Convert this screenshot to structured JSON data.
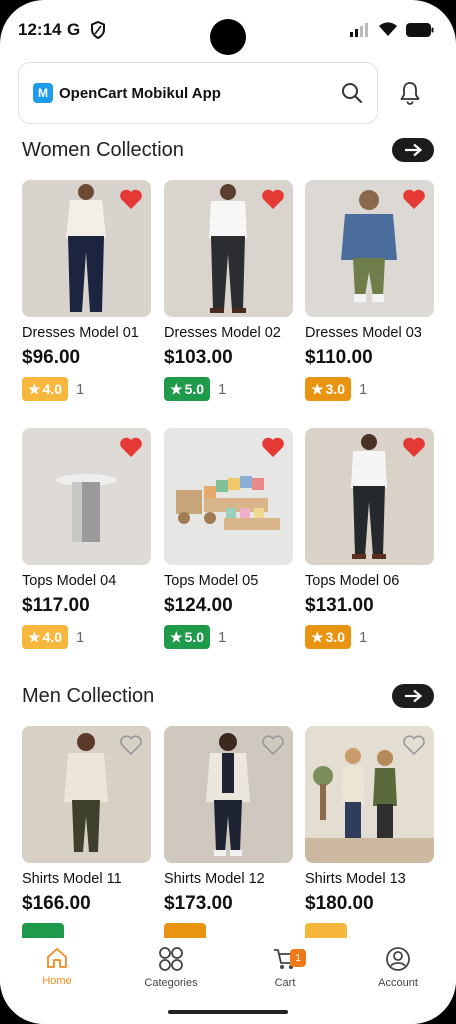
{
  "status": {
    "time": "12:14",
    "g_glyph": "G"
  },
  "header": {
    "logo_glyph": "M",
    "app_title": "OpenCart Mobikul App"
  },
  "sections": [
    {
      "title": "Women Collection"
    },
    {
      "title": "Men Collection"
    }
  ],
  "products": [
    {
      "name": "Dresses Model 01",
      "price": "$96.00",
      "rating": "4.0",
      "count": "1",
      "rating_color": "#f6b73c",
      "wishlisted": true
    },
    {
      "name": "Dresses Model 02",
      "price": "$103.00",
      "rating": "5.0",
      "count": "1",
      "rating_color": "#1f9a4a",
      "wishlisted": true
    },
    {
      "name": "Dresses Model 03",
      "price": "$110.00",
      "rating": "3.0",
      "count": "1",
      "rating_color": "#e89410",
      "wishlisted": true
    },
    {
      "name": "Tops Model 04",
      "price": "$117.00",
      "rating": "4.0",
      "count": "1",
      "rating_color": "#f6b73c",
      "wishlisted": true
    },
    {
      "name": "Tops Model 05",
      "price": "$124.00",
      "rating": "5.0",
      "count": "1",
      "rating_color": "#1f9a4a",
      "wishlisted": true
    },
    {
      "name": "Tops Model 06",
      "price": "$131.00",
      "rating": "3.0",
      "count": "1",
      "rating_color": "#e89410",
      "wishlisted": true
    },
    {
      "name": "Shirts Model 11",
      "price": "$166.00",
      "rating_color": "#1f9a4a",
      "wishlisted": false
    },
    {
      "name": "Shirts Model 12",
      "price": "$173.00",
      "rating_color": "#e89410",
      "wishlisted": false
    },
    {
      "name": "Shirts Model 13",
      "price": "$180.00",
      "rating_color": "#f6b73c",
      "wishlisted": false
    }
  ],
  "nav": {
    "home": "Home",
    "categories": "Categories",
    "cart": "Cart",
    "cart_count": "1",
    "account": "Account"
  },
  "colors": {
    "accent": "#f08a1f",
    "heart": "#e53935"
  }
}
